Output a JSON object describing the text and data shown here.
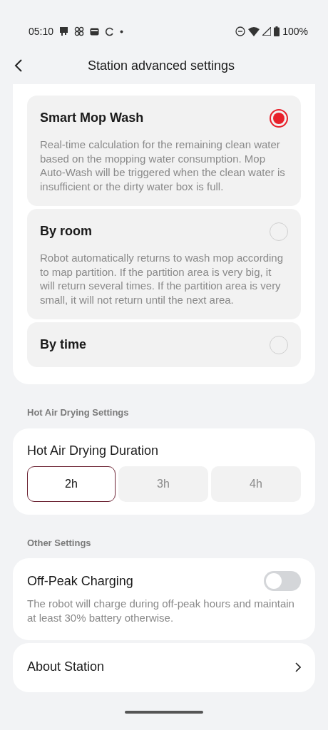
{
  "status_bar": {
    "time": "05:10",
    "battery": "100%"
  },
  "header": {
    "title": "Station advanced settings"
  },
  "wash_modes": [
    {
      "title": "Smart Mop Wash",
      "selected": true,
      "description": "Real-time calculation for the remaining clean water based on the mopping water consumption. Mop Auto-Wash will be triggered when the clean water is insufficient or the dirty water box is full."
    },
    {
      "title": "By room",
      "selected": false,
      "description": "Robot automatically returns to wash mop according to map partition. If the partition area is very big, it will return several times. If the partition area is very small, it will not return until the next area."
    },
    {
      "title": "By time",
      "selected": false
    }
  ],
  "drying_section": {
    "heading": "Hot Air Drying Settings",
    "title": "Hot Air Drying Duration",
    "options": [
      {
        "label": "2h",
        "selected": true
      },
      {
        "label": "3h",
        "selected": false
      },
      {
        "label": "4h",
        "selected": false
      }
    ]
  },
  "other_section": {
    "heading": "Other Settings",
    "off_peak": {
      "title": "Off-Peak Charging",
      "on": false,
      "description": "The robot will charge during off-peak hours and maintain at least 30% battery otherwise."
    },
    "about": {
      "title": "About Station"
    }
  }
}
